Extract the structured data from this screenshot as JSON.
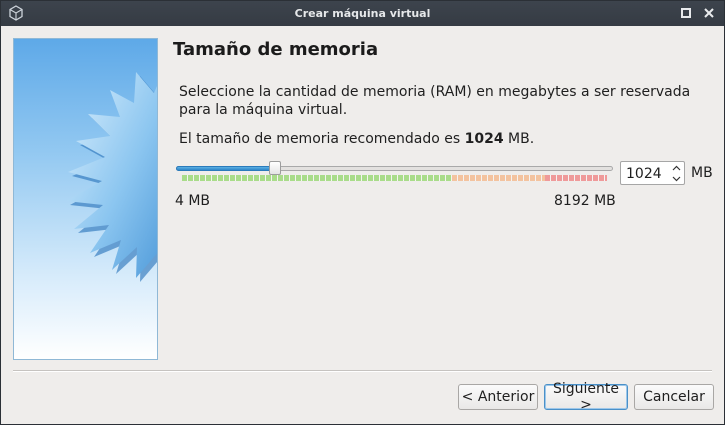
{
  "window": {
    "title": "Crear máquina virtual",
    "app_icon": "virtualbox-icon",
    "maximize_icon": "maximize-icon",
    "close_icon": "close-icon"
  },
  "page": {
    "title": "Tamaño de memoria",
    "description": "Seleccione la cantidad de memoria (RAM) en megabytes a ser reservada para la máquina virtual.",
    "recommend_prefix": "El tamaño de memoria recomendado es ",
    "recommend_value": "1024",
    "recommend_suffix": " MB."
  },
  "memory": {
    "value": "1024",
    "unit": "MB",
    "min_label": "4 MB",
    "max_label": "8192 MB",
    "min_mb": 4,
    "max_mb": 8192,
    "current_mb": 1024,
    "zones": [
      {
        "name": "safe",
        "fraction": 0.635,
        "color": "#a9dc8a"
      },
      {
        "name": "warning",
        "fraction": 0.22,
        "color": "#f3c39f"
      },
      {
        "name": "danger",
        "fraction": 0.145,
        "color": "#ef9a9a"
      }
    ]
  },
  "buttons": {
    "back": "< Anterior",
    "next": "Siguiente >",
    "cancel": "Cancelar"
  },
  "colors": {
    "accent": "#2e86c9",
    "titlebar": "#3a4048"
  }
}
